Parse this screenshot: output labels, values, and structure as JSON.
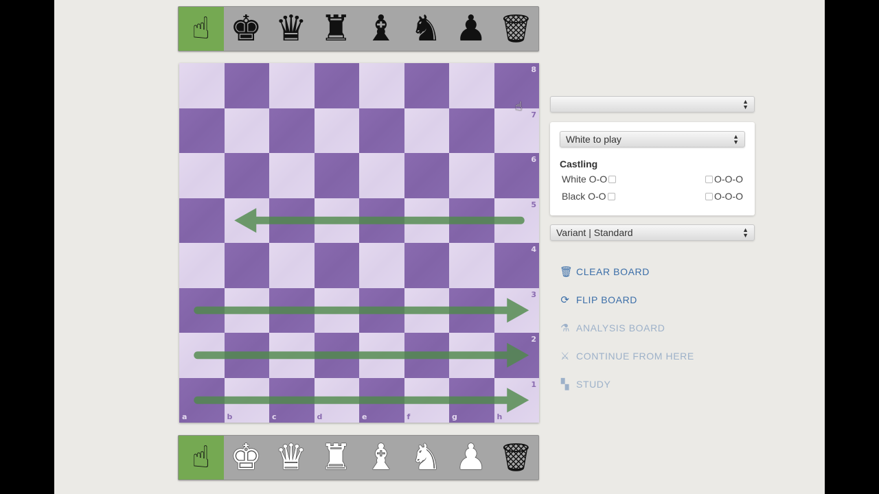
{
  "palette_top": {
    "items": [
      {
        "name": "pointer",
        "glyph": "☝",
        "active": true
      },
      {
        "name": "king",
        "glyph": "♚"
      },
      {
        "name": "queen",
        "glyph": "♛"
      },
      {
        "name": "rook",
        "glyph": "♜"
      },
      {
        "name": "bishop",
        "glyph": "♝"
      },
      {
        "name": "knight",
        "glyph": "♞"
      },
      {
        "name": "pawn",
        "glyph": "♟"
      },
      {
        "name": "trash",
        "glyph": "🗑"
      }
    ]
  },
  "palette_bottom": {
    "items": [
      {
        "name": "pointer",
        "glyph": "☝",
        "active": true
      },
      {
        "name": "king",
        "glyph": "♚"
      },
      {
        "name": "queen",
        "glyph": "♛"
      },
      {
        "name": "rook",
        "glyph": "♜"
      },
      {
        "name": "bishop",
        "glyph": "♝"
      },
      {
        "name": "knight",
        "glyph": "♞"
      },
      {
        "name": "pawn",
        "glyph": "♟"
      },
      {
        "name": "trash",
        "glyph": "🗑"
      }
    ]
  },
  "board": {
    "files": [
      "a",
      "b",
      "c",
      "d",
      "e",
      "f",
      "g",
      "h"
    ],
    "ranks": [
      "8",
      "7",
      "6",
      "5",
      "4",
      "3",
      "2",
      "1"
    ],
    "colors": {
      "light": "#e1d6ee",
      "dark": "#8667ac",
      "arrow": "#4f8a4a"
    },
    "arrows": [
      {
        "from": "h5",
        "to": "b5"
      },
      {
        "from": "a3",
        "to": "h3"
      },
      {
        "from": "a2",
        "to": "h2"
      },
      {
        "from": "a1",
        "to": "h1"
      }
    ]
  },
  "position_select": {
    "value": ""
  },
  "turn_select": {
    "value": "White to play"
  },
  "castling": {
    "title": "Castling",
    "white_label": "White O-O",
    "white_long": "O-O-O",
    "black_label": "Black O-O",
    "black_long": "O-O-O"
  },
  "variant_select": {
    "value": "Variant | Standard"
  },
  "actions": [
    {
      "label": "CLEAR BOARD",
      "icon": "trash-icon",
      "glyph": "🗑",
      "enabled": true
    },
    {
      "label": "FLIP BOARD",
      "icon": "flip-icon",
      "glyph": "⟳",
      "enabled": true
    },
    {
      "label": "ANALYSIS BOARD",
      "icon": "microscope-icon",
      "glyph": "⚗",
      "enabled": false
    },
    {
      "label": "CONTINUE FROM HERE",
      "icon": "swords-icon",
      "glyph": "⚔",
      "enabled": false
    },
    {
      "label": "STUDY",
      "icon": "study-icon",
      "glyph": "▚",
      "enabled": false
    }
  ]
}
